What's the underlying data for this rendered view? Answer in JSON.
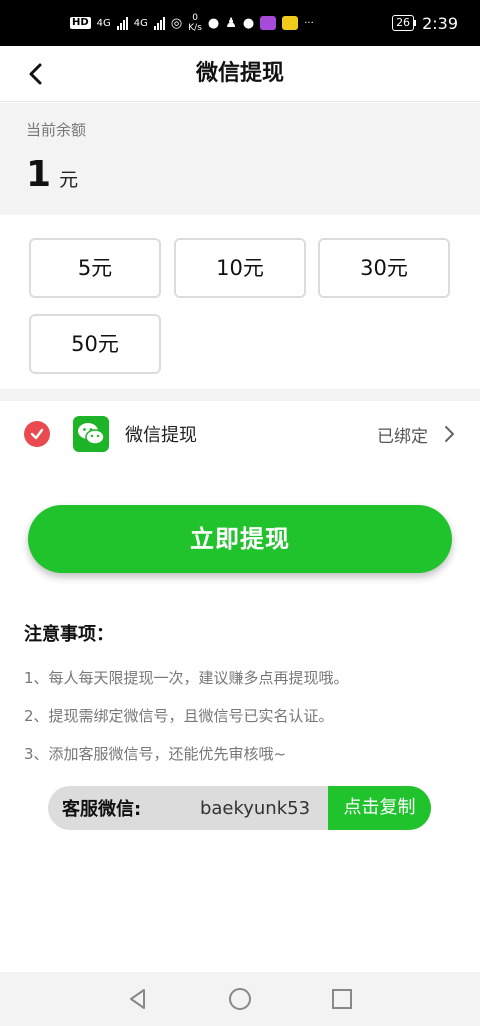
{
  "status_bar": {
    "hd_label": "HD",
    "net1": "4G",
    "net2": "4G",
    "speed_value": "0",
    "speed_unit": "K/s",
    "battery": "26",
    "time": "2:39"
  },
  "header": {
    "title": "微信提现"
  },
  "balance": {
    "label": "当前余额",
    "value": "1",
    "unit": "元"
  },
  "amounts": [
    "5元",
    "10元",
    "30元",
    "50元"
  ],
  "method": {
    "label": "微信提现",
    "status": "已绑定"
  },
  "withdraw_button": "立即提现",
  "notes": {
    "title": "注意事项：",
    "items": [
      "1、每人每天限提现一次，建议赚多点再提现哦。",
      "2、提现需绑定微信号，且微信号已实名认证。",
      "3、添加客服微信号，还能优先审核哦~"
    ]
  },
  "customer_service": {
    "label": "客服微信:",
    "wechat_id": "baekyunk53",
    "copy_button": "点击复制"
  },
  "colors": {
    "accent_green": "#21c32d",
    "check_red": "#e84a4f",
    "wechat_green": "#1db527"
  },
  "icons": [
    "back-arrow-icon",
    "check-icon",
    "wechat-icon",
    "chevron-right-icon",
    "nav-back-icon",
    "nav-home-icon",
    "nav-recents-icon"
  ]
}
